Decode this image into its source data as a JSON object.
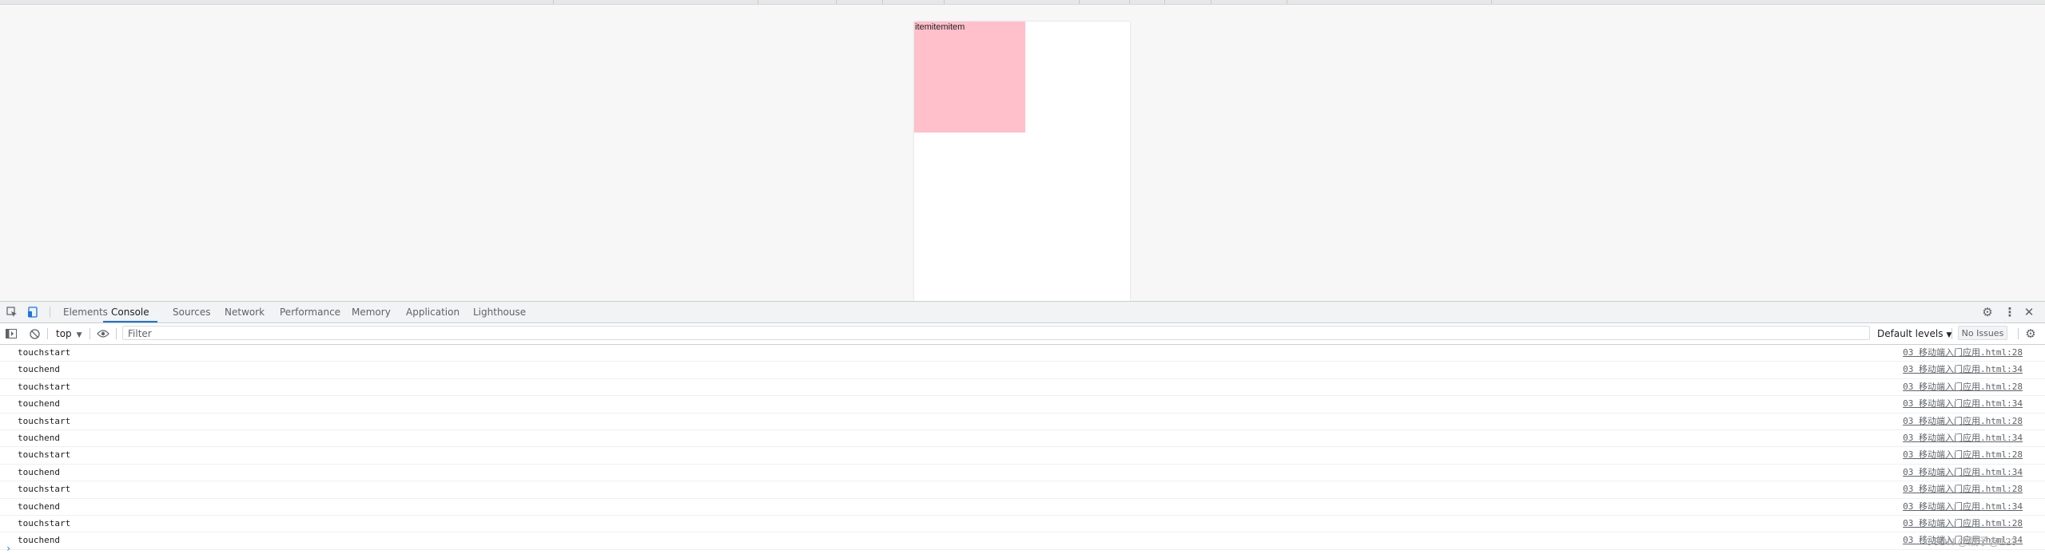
{
  "viewport": {
    "item_text": "itemitemitem",
    "box_color": "#ffc0cb"
  },
  "toolbar": {
    "inspect_icon": "inspect-element-icon",
    "device_icon": "device-toolbar-icon",
    "tabs": [
      "Elements",
      "Console",
      "Sources",
      "Network",
      "Performance",
      "Memory",
      "Application",
      "Lighthouse"
    ],
    "active_tab": "Console",
    "settings_icon": "gear-icon",
    "more_icon": "kebab-menu-icon",
    "close_icon": "close-icon"
  },
  "console_toolbar": {
    "sidebar_icon": "sidebar-toggle-icon",
    "clear_icon": "clear-console-icon",
    "context": "top",
    "eye_icon": "eye-icon",
    "filter_placeholder": "Filter",
    "levels": "Default levels",
    "issues": "No Issues",
    "settings_icon": "gear-icon"
  },
  "logs": [
    {
      "msg": "touchstart",
      "src": "03 移动端入门应用.html:28"
    },
    {
      "msg": "touchend",
      "src": "03 移动端入门应用.html:34"
    },
    {
      "msg": "touchstart",
      "src": "03 移动端入门应用.html:28"
    },
    {
      "msg": "touchend",
      "src": "03 移动端入门应用.html:34"
    },
    {
      "msg": "touchstart",
      "src": "03 移动端入门应用.html:28"
    },
    {
      "msg": "touchend",
      "src": "03 移动端入门应用.html:34"
    },
    {
      "msg": "touchstart",
      "src": "03 移动端入门应用.html:28"
    },
    {
      "msg": "touchend",
      "src": "03 移动端入门应用.html:34"
    },
    {
      "msg": "touchstart",
      "src": "03 移动端入门应用.html:28"
    },
    {
      "msg": "touchend",
      "src": "03 移动端入门应用.html:34"
    },
    {
      "msg": "touchstart",
      "src": "03 移动端入门应用.html:28"
    },
    {
      "msg": "touchend",
      "src": "03 移动端入门应用.html:34"
    }
  ],
  "prompt": "›",
  "watermark": "CSDN @赋予@123",
  "accent": "#1a73e8"
}
